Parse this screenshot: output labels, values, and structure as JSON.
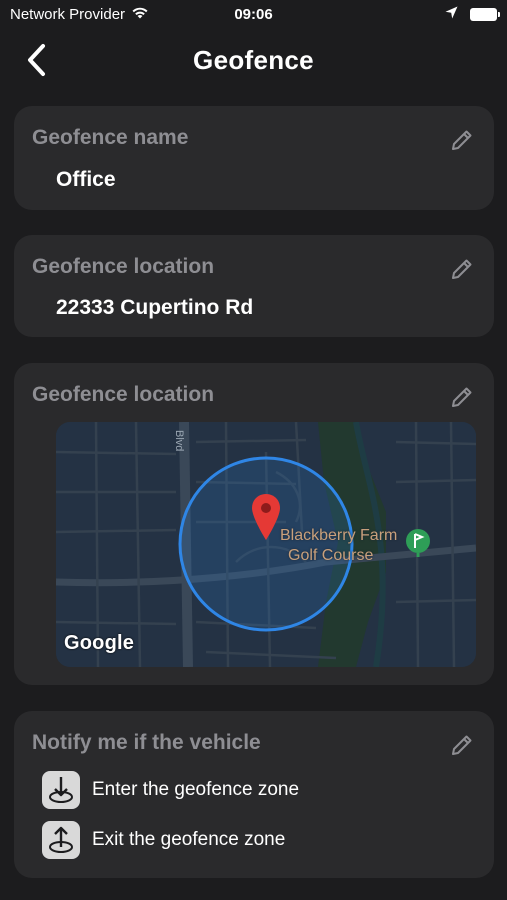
{
  "status_bar": {
    "carrier": "Network Provider",
    "time": "09:06",
    "icons": [
      "wifi-icon",
      "location-arrow-icon",
      "battery-icon"
    ]
  },
  "nav": {
    "title": "Geofence",
    "back_icon": "chevron-left-icon"
  },
  "cards": {
    "name": {
      "label": "Geofence name",
      "value": "Office",
      "edit_icon": "pencil-icon"
    },
    "location": {
      "label": "Geofence location",
      "value": "22333 Cupertino Rd",
      "edit_icon": "pencil-icon"
    },
    "map": {
      "label": "Geofence location",
      "edit_icon": "pencil-icon",
      "street_label": "Blvd",
      "poi_line1": "Blackberry Farm",
      "poi_line2": "Golf Course",
      "attribution": "Google",
      "pin_icon": "map-pin-icon",
      "golf_icon": "golf-icon"
    },
    "notify": {
      "label": "Notify me if the vehicle",
      "edit_icon": "pencil-icon",
      "options": [
        {
          "label": "Enter the geofence zone",
          "icon": "enter-zone-icon"
        },
        {
          "label": "Exit the geofence zone",
          "icon": "exit-zone-icon"
        }
      ]
    }
  },
  "colors": {
    "background": "#1c1c1e",
    "card": "#2a2a2c",
    "label": "#8e8e93",
    "geofence_circle": "#2f86e6",
    "pin": "#e53935",
    "poi_text": "#c8a07c",
    "golf_badge": "#2e9e57"
  }
}
